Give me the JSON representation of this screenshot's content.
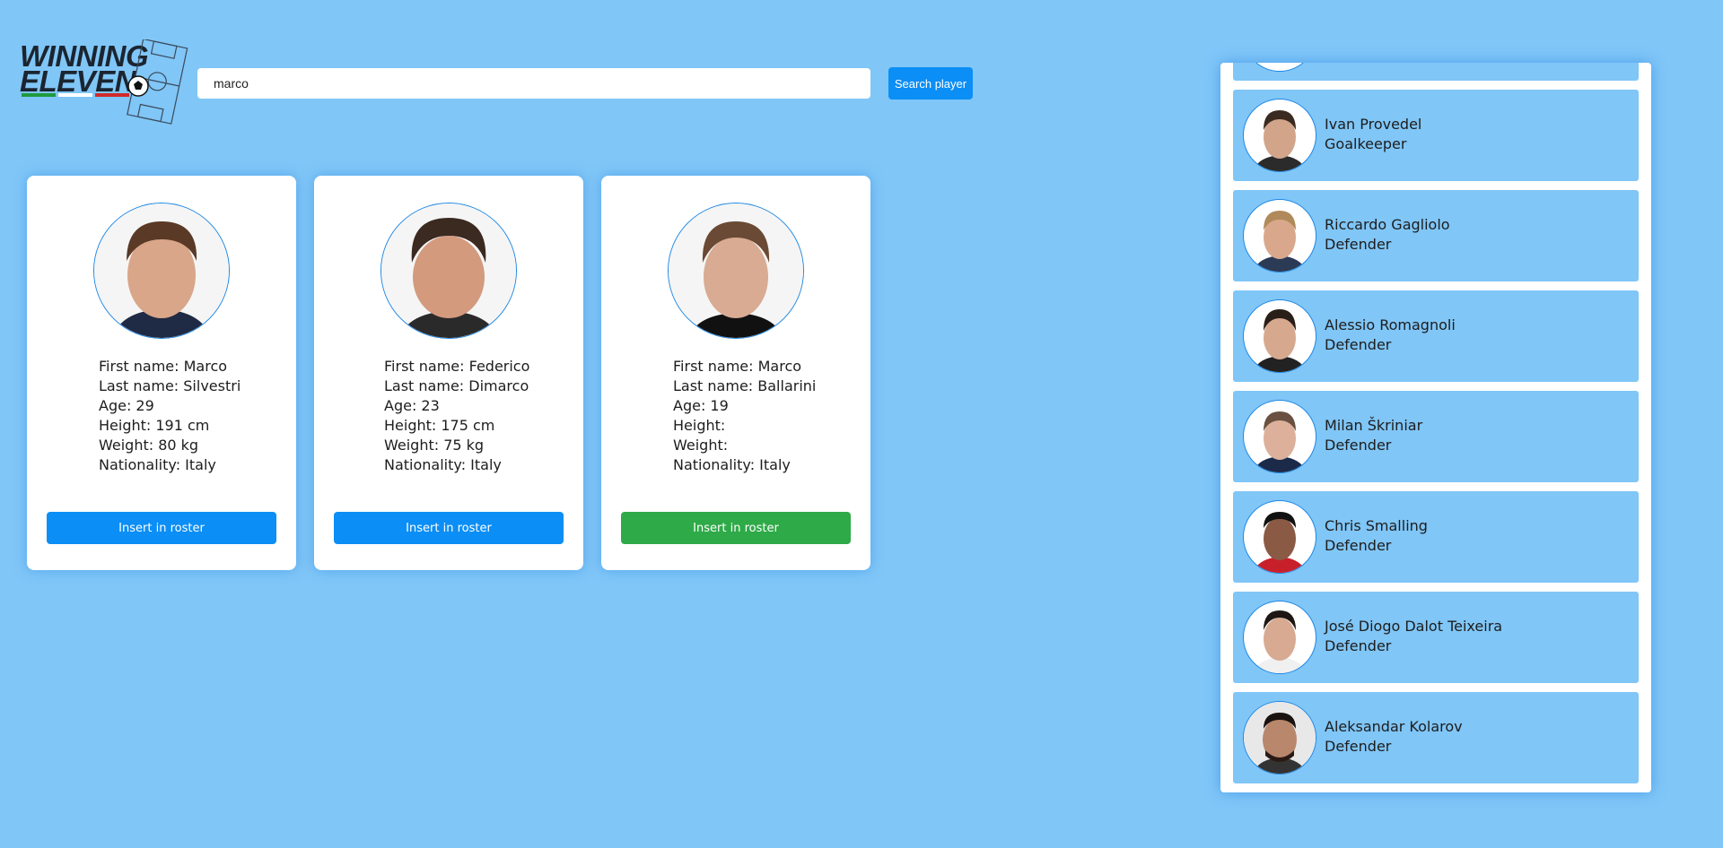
{
  "logo": {
    "line1": "WINNING",
    "line2": "ELEVEN"
  },
  "search": {
    "value": "marco",
    "button": "Search player"
  },
  "cards": [
    {
      "first_name": "First name: Marco",
      "last_name": "Last name: Silvestri",
      "age": "Age: 29",
      "height": "Height: 191 cm",
      "weight": "Weight: 80 kg",
      "nationality": "Nationality: Italy",
      "button": "Insert in roster",
      "button_color": "#0b8ef5"
    },
    {
      "first_name": "First name: Federico",
      "last_name": "Last name: Dimarco",
      "age": "Age: 23",
      "height": "Height: 175 cm",
      "weight": "Weight: 75 kg",
      "nationality": "Nationality: Italy",
      "button": "Insert in roster",
      "button_color": "#0b8ef5"
    },
    {
      "first_name": "First name: Marco",
      "last_name": "Last name: Ballarini",
      "age": "Age: 19",
      "height": "Height:",
      "weight": "Weight:",
      "nationality": "Nationality: Italy",
      "button": "Insert in roster",
      "button_color": "#2eaa48"
    }
  ],
  "roster": [
    {
      "name": "Ivan Provedel",
      "role": "Goalkeeper"
    },
    {
      "name": "Riccardo Gagliolo",
      "role": "Defender"
    },
    {
      "name": "Alessio Romagnoli",
      "role": "Defender"
    },
    {
      "name": "Milan Škriniar",
      "role": "Defender"
    },
    {
      "name": "Chris Smalling",
      "role": "Defender"
    },
    {
      "name": "José Diogo Dalot Teixeira",
      "role": "Defender"
    },
    {
      "name": "Aleksandar Kolarov",
      "role": "Defender"
    }
  ],
  "colors": {
    "background": "#80c6f7",
    "primary_button": "#0b8ef5",
    "selected_button": "#2eaa48",
    "avatar_border": "#1e88e5"
  }
}
